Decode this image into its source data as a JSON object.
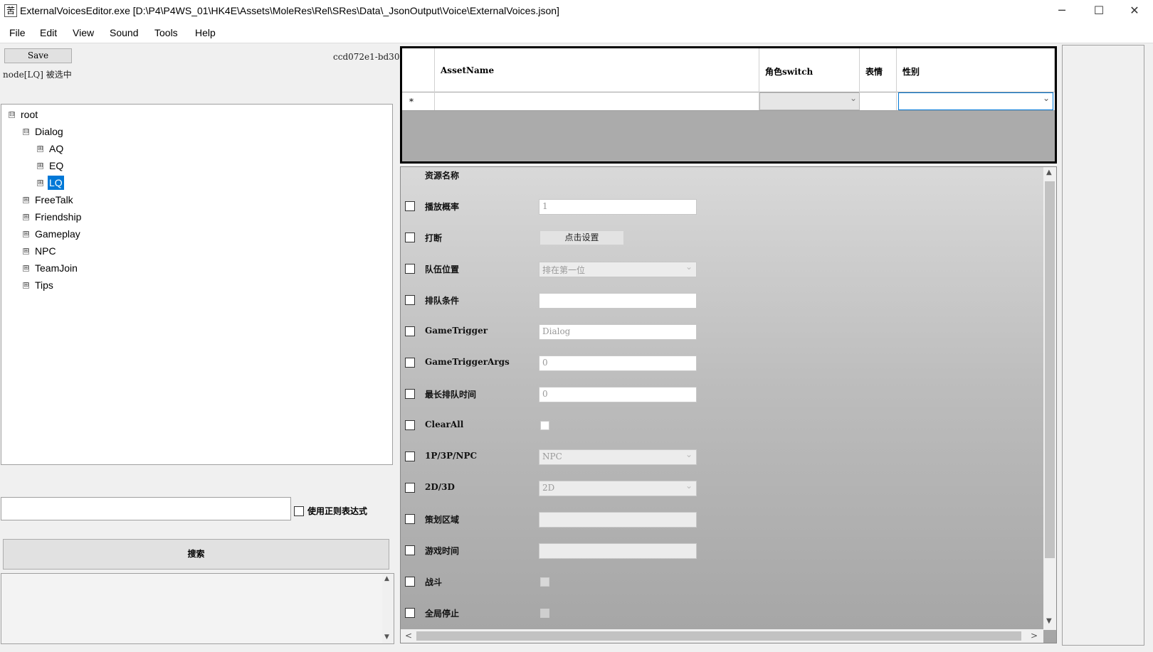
{
  "window": {
    "icon_glyph": "苦",
    "title": "ExternalVoicesEditor.exe [D:\\P4\\P4WS_01\\HK4E\\Assets\\MoleRes\\Rel\\SRes\\Data\\_JsonOutput\\Voice\\ExternalVoices.json]",
    "minimize": "─",
    "maximize": "☐",
    "close": "✕"
  },
  "menu": [
    "File",
    "Edit",
    "View",
    "Sound",
    "Tools",
    "Help"
  ],
  "left": {
    "save_label": "Save",
    "guid": "ccd072e1-bd30",
    "status": "node[LQ] 被选中",
    "tree": {
      "root": "root",
      "dialog": "Dialog",
      "aq": "AQ",
      "eq": "EQ",
      "lq": "LQ",
      "freetalk": "FreeTalk",
      "friendship": "Friendship",
      "gameplay": "Gameplay",
      "npc": "NPC",
      "teamjoin": "TeamJoin",
      "tips": "Tips",
      "expand": "⊞",
      "collapse": "⊟"
    },
    "search": {
      "value": "",
      "regex_label": "使用正则表达式",
      "button_label": "搜索"
    }
  },
  "grid": {
    "columns": [
      "AssetName",
      "角色switch",
      "表情",
      "性别"
    ],
    "new_row_marker": "*",
    "dropdown_glyph": "⌄"
  },
  "props": {
    "header": "资源名称",
    "fields": [
      {
        "label": "播放概率",
        "value": "1"
      },
      {
        "label": "打断",
        "button": "点击设置"
      },
      {
        "label": "队伍位置",
        "value": "排在第一位"
      },
      {
        "label": "排队条件",
        "value": ""
      },
      {
        "label": "GameTrigger",
        "value": "Dialog"
      },
      {
        "label": "GameTriggerArgs",
        "value": "0"
      },
      {
        "label": "最长排队时间",
        "value": "0"
      },
      {
        "label": "ClearAll"
      },
      {
        "label": "1P/3P/NPC",
        "value": "NPC"
      },
      {
        "label": "2D/3D",
        "value": "2D"
      },
      {
        "label": "策划区域",
        "value": ""
      },
      {
        "label": "游戏时间",
        "value": ""
      },
      {
        "label": "战斗"
      },
      {
        "label": "全局停止"
      }
    ],
    "scroll_up": "▲",
    "scroll_down": "▼",
    "scroll_left": "<",
    "scroll_right": ">"
  }
}
